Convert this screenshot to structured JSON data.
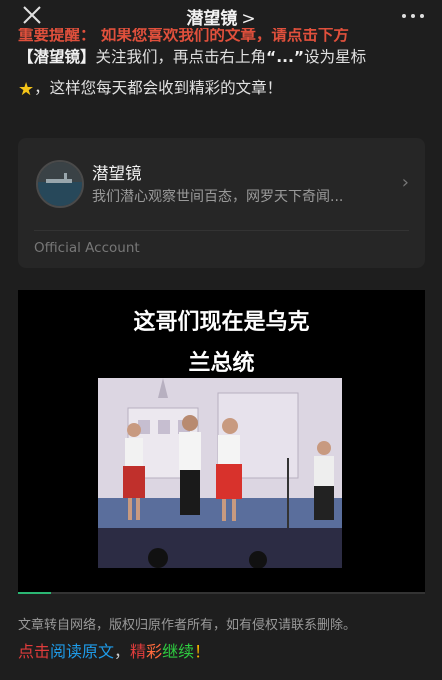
{
  "header": {
    "title": "潜望镜",
    "chevron": ">"
  },
  "intro": {
    "partial_line": "重要提醒： 如果您喜欢我们的文章，请点击下方",
    "bracket_name": "【潜望镜】",
    "line2_rest": "关注我们，再点击右上角",
    "dots": "“...”",
    "line2_end": "设为星标",
    "line3": "，这样您每天都会收到精彩的文章！"
  },
  "account_card": {
    "name": "潜望镜",
    "description": "我们潜心观察世间百态，网罗天下奇闻...",
    "official_label": "Official Account",
    "chevron": "›"
  },
  "video": {
    "caption_line1": "这哥们现在是乌克",
    "caption_line2": "兰总统",
    "progress": 0.08
  },
  "footer": {
    "note": "文章转自网络，版权归原作者所有，如有侵权请联系删除。",
    "cta": [
      "点击",
      "阅读原文",
      "，",
      "精",
      "彩",
      "继续",
      "！"
    ]
  },
  "colors": {
    "accent_green": "#2bb673",
    "background": "#1e1e1e"
  },
  "icons": [
    "close-icon",
    "more-icon",
    "star-icon",
    "chevron-right-icon"
  ]
}
